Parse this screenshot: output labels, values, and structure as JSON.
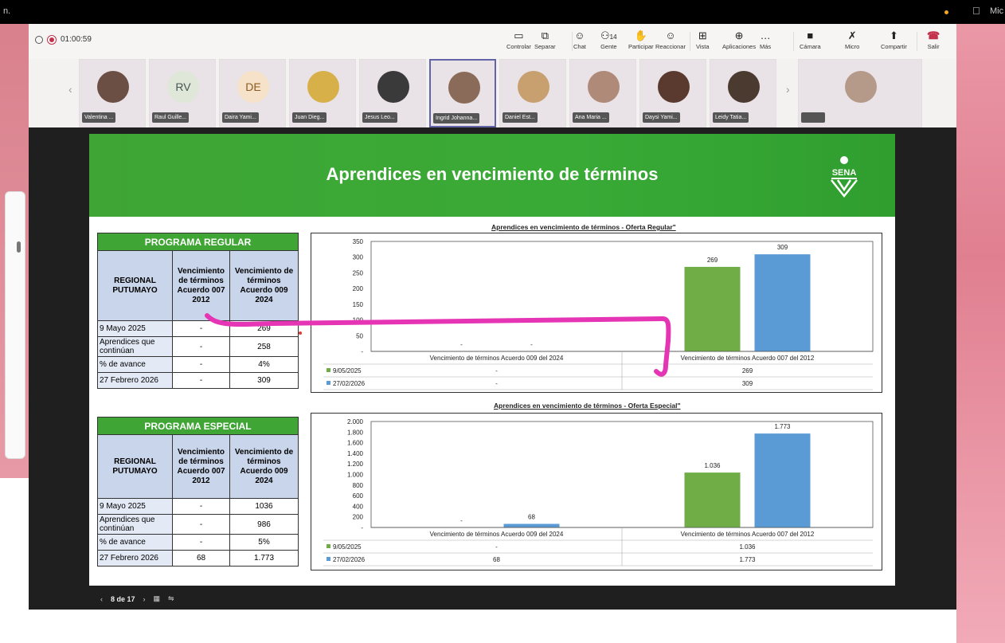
{
  "os": {
    "left_fragment": "n.",
    "right_fragment": "Mic"
  },
  "meeting": {
    "timer": "01:00:59",
    "toolbar": [
      {
        "label": "Controlar",
        "icon": "control-icon"
      },
      {
        "label": "Separar",
        "icon": "popout-icon"
      },
      {
        "label": "Chat",
        "icon": "chat-icon"
      },
      {
        "label": "Gente",
        "icon": "people-icon",
        "badge": "14"
      },
      {
        "label": "Participar",
        "icon": "raise-hand-icon"
      },
      {
        "label": "Reaccionar",
        "icon": "reaction-icon"
      },
      {
        "label": "Vista",
        "icon": "grid-icon"
      },
      {
        "label": "Aplicaciones",
        "icon": "apps-icon"
      },
      {
        "label": "Más",
        "icon": "more-icon"
      },
      {
        "label": "Cámara",
        "icon": "camera-off-icon"
      },
      {
        "label": "Micro",
        "icon": "mic-off-icon"
      },
      {
        "label": "Compartir",
        "icon": "share-icon"
      },
      {
        "label": "Salir",
        "icon": "leave-icon"
      }
    ],
    "participants": [
      {
        "name": "Valentina ...",
        "initials": ""
      },
      {
        "name": "Raul Guille...",
        "initials": "RV"
      },
      {
        "name": "Daira Yami...",
        "initials": "DE"
      },
      {
        "name": "Juan Dieg...",
        "initials": ""
      },
      {
        "name": "Jesus Leo...",
        "initials": ""
      },
      {
        "name": "Ingrid Johanna...",
        "initials": ""
      },
      {
        "name": "Daniel Est...",
        "initials": ""
      },
      {
        "name": "Ana Maria ...",
        "initials": ""
      },
      {
        "name": "Daysi Yami...",
        "initials": ""
      },
      {
        "name": "Leidy Tatia...",
        "initials": ""
      }
    ],
    "self_tile": ""
  },
  "slide": {
    "title": "Aprendices en vencimiento de términos",
    "logo_text": "SENA",
    "page": "8 de 17",
    "regular": {
      "header": "PROGRAMA REGULAR",
      "col0": "REGIONAL PUTUMAYO",
      "col1": "Vencimiento de términos Acuerdo 007 2012",
      "col2": "Vencimiento de términos Acuerdo 009 2024",
      "rows": [
        [
          "9 Mayo 2025",
          "-",
          "269"
        ],
        [
          "Aprendices que continúan",
          "-",
          "258"
        ],
        [
          "% de avance",
          "-",
          "4%"
        ],
        [
          "27 Febrero 2026",
          "-",
          "309"
        ]
      ]
    },
    "especial": {
      "header": "PROGRAMA ESPECIAL",
      "col0": "REGIONAL PUTUMAYO",
      "col1": "Vencimiento de términos Acuerdo 007 2012",
      "col2": "Vencimiento de términos Acuerdo 009 2024",
      "rows": [
        [
          "9 Mayo 2025",
          "-",
          "1036"
        ],
        [
          "Aprendices que continúan",
          "-",
          "986"
        ],
        [
          "% de avance",
          "-",
          "5%"
        ],
        [
          "27 Febrero 2026",
          "68",
          "1.773"
        ]
      ]
    }
  },
  "chart_data": [
    {
      "type": "bar",
      "title": "Aprendices en vencimiento de términos - Oferta Regular\"",
      "categories": [
        "Vencimiento de términos Acuerdo 009 del 2024",
        "Vencimiento de términos Acuerdo 007 del 2012"
      ],
      "series": [
        {
          "name": "9/05/2025",
          "values": [
            0,
            269
          ],
          "labels": [
            "-",
            "269"
          ],
          "color": "#70ad47"
        },
        {
          "name": "27/02/2026",
          "values": [
            0,
            309
          ],
          "labels": [
            "-",
            "309"
          ],
          "color": "#5b9bd5"
        }
      ],
      "yticks": [
        "350",
        "300",
        "250",
        "200",
        "150",
        "100",
        "50",
        "-"
      ],
      "ylim": [
        0,
        350
      ]
    },
    {
      "type": "bar",
      "title": "Aprendices en vencimiento de términos - Oferta  Especial\"",
      "categories": [
        "Vencimiento de términos Acuerdo 009 del 2024",
        "Vencimiento de términos Acuerdo 007 del 2012"
      ],
      "series": [
        {
          "name": "9/05/2025",
          "values": [
            0,
            1036
          ],
          "labels": [
            "-",
            "1.036"
          ],
          "color": "#70ad47"
        },
        {
          "name": "27/02/2026",
          "values": [
            68,
            1773
          ],
          "labels": [
            "68",
            "1.773"
          ],
          "color": "#5b9bd5"
        }
      ],
      "yticks": [
        "2.000",
        "1.800",
        "1.600",
        "1.400",
        "1.200",
        "1.000",
        "800",
        "600",
        "400",
        "200",
        "-"
      ],
      "ylim": [
        0,
        2000
      ]
    }
  ]
}
